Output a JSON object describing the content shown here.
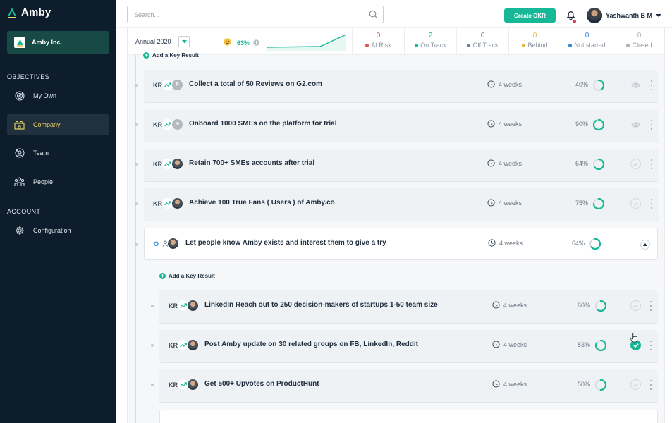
{
  "app": {
    "name": "Amby"
  },
  "org": {
    "name": "Amby Inc."
  },
  "sidebar": {
    "objectives_heading": "OBJECTIVES",
    "account_heading": "ACCOUNT",
    "items": [
      {
        "label": "My Own",
        "icon": "target-icon"
      },
      {
        "label": "Company",
        "icon": "building-icon",
        "active": true
      },
      {
        "label": "Team",
        "icon": "team-icon"
      },
      {
        "label": "People",
        "icon": "people-icon"
      },
      {
        "label": "Configuration",
        "icon": "gear-icon"
      }
    ]
  },
  "topbar": {
    "search_placeholder": "Search...",
    "create_label": "Create OKR",
    "user_name": "Yashwanth B M"
  },
  "stats": {
    "period": "Annual 2020",
    "overall_pct": "63%",
    "items": [
      {
        "count": "0",
        "label": "At Risk",
        "color": "#e05252"
      },
      {
        "count": "2",
        "label": "On Track",
        "color": "#17b897"
      },
      {
        "count": "0",
        "label": "Off Track",
        "color": "#5f7f9a"
      },
      {
        "count": "0",
        "label": "Behind",
        "color": "#e8b13a"
      },
      {
        "count": "0",
        "label": "Not started",
        "color": "#2d86d6"
      },
      {
        "count": "0",
        "label": "Closed",
        "color": "#a9b0b7"
      }
    ]
  },
  "add_kr_label": "Add a Key Result",
  "key_results": [
    {
      "badge": "KR",
      "avatar": "P",
      "title": "Collect a total of 50 Reviews on G2.com",
      "duration": "4 weeks",
      "progress": "40%",
      "value": 0.4,
      "action": "eye-icon"
    },
    {
      "badge": "KR",
      "avatar": "N",
      "title": "Onboard 1000 SMEs on the platform for trial",
      "duration": "4 weeks",
      "progress": "90%",
      "value": 0.9,
      "action": "eye-icon"
    },
    {
      "badge": "KR",
      "avatar": "",
      "title": "Retain 700+ SMEs accounts after trial",
      "duration": "4 weeks",
      "progress": "64%",
      "value": 0.64,
      "action": "check-icon"
    },
    {
      "badge": "KR",
      "avatar": "",
      "title": "Achieve 100 True Fans ( Users ) of Amby.co",
      "duration": "4 weeks",
      "progress": "75%",
      "value": 0.75,
      "action": "check-icon"
    }
  ],
  "objective": {
    "badge": "O",
    "title": "Let people know Amby exists and interest them to give a try",
    "duration": "4 weeks",
    "progress": "64%",
    "value": 0.64
  },
  "sub_key_results": [
    {
      "badge": "KR",
      "title": "LinkedIn Reach out to 250 decision-makers of startups 1-50 team size",
      "duration": "4 weeks",
      "progress": "60%",
      "value": 0.6,
      "done": false
    },
    {
      "badge": "KR",
      "title": "Post Amby update on 30 related groups on FB, LinkedIn, Reddit",
      "duration": "4 weeks",
      "progress": "83%",
      "value": 0.83,
      "done": true
    },
    {
      "badge": "KR",
      "title": "Get 500+ Upvotes on ProductHunt",
      "duration": "4 weeks",
      "progress": "50%",
      "value": 0.5,
      "done": false
    }
  ]
}
